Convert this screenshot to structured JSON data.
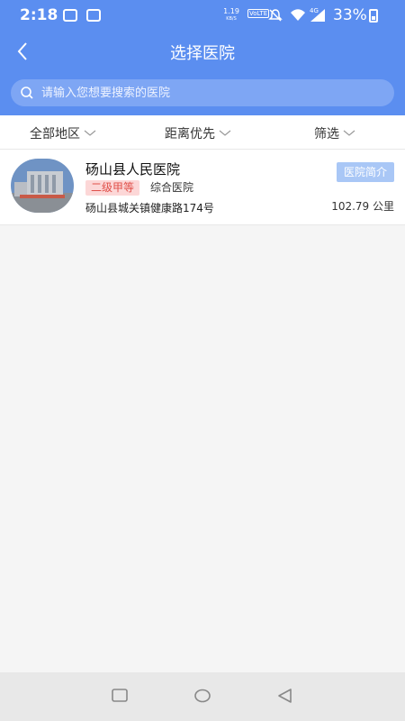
{
  "status": {
    "time": "2:18",
    "net_speed_value": "1.19",
    "net_speed_unit": "KB/S",
    "volte": "VoLTE",
    "signal_tag": "4G",
    "battery": "33%"
  },
  "nav": {
    "title": "选择医院"
  },
  "search": {
    "placeholder": "请输入您想要搜索的医院"
  },
  "filters": [
    {
      "label": "全部地区"
    },
    {
      "label": "距离优先"
    },
    {
      "label": "筛选"
    }
  ],
  "hospitals": [
    {
      "name": "砀山县人民医院",
      "grade": "二级甲等",
      "type": "综合医院",
      "address": "砀山县城关镇健康路174号",
      "intro_button": "医院简介",
      "distance": "102.79 公里"
    }
  ],
  "colors": {
    "primary": "#5b8ef0",
    "badge_bg": "#fcd7d7",
    "badge_text": "#e0504a",
    "intro_button_bg": "#a9c7f6"
  }
}
